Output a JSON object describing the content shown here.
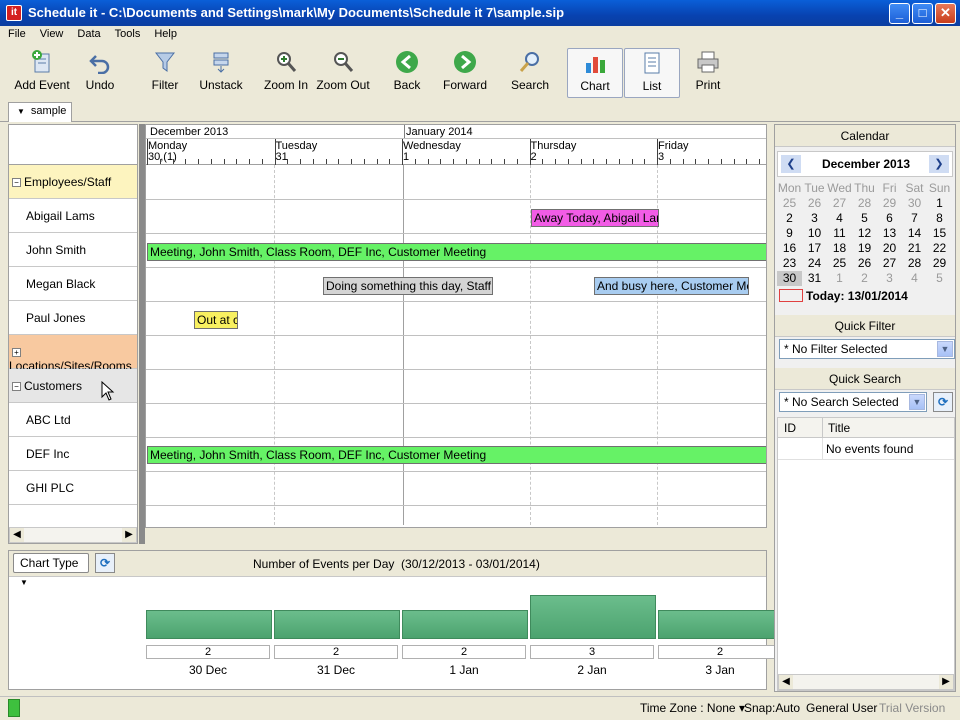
{
  "window": {
    "app_icon": "it",
    "title": "Schedule it - C:\\Documents and Settings\\mark\\My Documents\\Schedule it 7\\sample.sip",
    "min_label": "_",
    "max_label": "□",
    "close_label": "✕"
  },
  "menu": [
    "File",
    "View",
    "Data",
    "Tools",
    "Help"
  ],
  "toolbar": {
    "add_event": "Add Event",
    "undo": "Undo",
    "filter": "Filter",
    "unstack": "Unstack",
    "zoom_in": "Zoom In",
    "zoom_out": "Zoom Out",
    "back": "Back",
    "forward": "Forward",
    "search": "Search",
    "chart": "Chart",
    "list": "List",
    "print": "Print"
  },
  "tab": {
    "arrow": "▼",
    "label": "sample"
  },
  "resources": {
    "group_employees": "Employees/Staff",
    "abigail": "Abigail Lams",
    "john": "John Smith",
    "megan": "Megan Black",
    "paul": "Paul Jones",
    "group_locations": "Locations/Sites/Rooms",
    "group_customers": "Customers",
    "abc": "ABC Ltd",
    "def": "DEF Inc",
    "ghi": "GHI PLC",
    "collapse_glyph": "−",
    "expand_glyph": "+"
  },
  "timeline": {
    "month1": "December 2013",
    "month2": "January 2014",
    "days": [
      {
        "name": "Monday",
        "num": "30,(1)"
      },
      {
        "name": "Tuesday",
        "num": "31"
      },
      {
        "name": "Wednesday",
        "num": "1"
      },
      {
        "name": "Thursday",
        "num": "2"
      },
      {
        "name": "Friday",
        "num": "3"
      }
    ]
  },
  "events": {
    "abigail": "Away Today, Abigail Lams",
    "john": "Meeting, John Smith, Class Room, DEF Inc, Customer Meeting",
    "megan1": "Doing something this day, Staff Meeting",
    "megan2": "And busy here, Customer Meeting",
    "paul": "Out at c",
    "def": "Meeting, John Smith, Class Room, DEF Inc, Customer Meeting"
  },
  "event_colors": {
    "abigail": "#f25ce6",
    "meeting": "#66f266",
    "megan1": "#d4d4d4",
    "megan2": "#a8ccf0",
    "paul": "#f8f060"
  },
  "chart_panel": {
    "chart_type_label": "Chart Type",
    "dropdown_arrow": "▼",
    "refresh_glyph": "⟳",
    "title": "Number of Events per Day  (30/12/2013 - 03/01/2014)"
  },
  "chart_data": {
    "type": "bar",
    "title": "Number of Events per Day  (30/12/2013 - 03/01/2014)",
    "categories": [
      "30 Dec",
      "31 Dec",
      "1 Jan",
      "2 Jan",
      "3 Jan"
    ],
    "values": [
      2,
      2,
      2,
      3,
      2
    ],
    "ylim": [
      0,
      3
    ],
    "grid": false,
    "bar_color": "#5cb07e"
  },
  "calendar": {
    "header": "Calendar",
    "month_label": "December 2013",
    "prev": "❮",
    "next": "❯",
    "weekdays": [
      "Mon",
      "Tue",
      "Wed",
      "Thu",
      "Fri",
      "Sat",
      "Sun"
    ],
    "weeks": [
      [
        "25",
        "26",
        "27",
        "28",
        "29",
        "30",
        "1"
      ],
      [
        "2",
        "3",
        "4",
        "5",
        "6",
        "7",
        "8"
      ],
      [
        "9",
        "10",
        "11",
        "12",
        "13",
        "14",
        "15"
      ],
      [
        "16",
        "17",
        "18",
        "19",
        "20",
        "21",
        "22"
      ],
      [
        "23",
        "24",
        "25",
        "26",
        "27",
        "28",
        "29"
      ],
      [
        "30",
        "31",
        "1",
        "2",
        "3",
        "4",
        "5"
      ]
    ],
    "today_label": "Today: 13/01/2014"
  },
  "quick_filter": {
    "header": "Quick Filter",
    "value": "* No Filter Selected"
  },
  "quick_search": {
    "header": "Quick Search",
    "value": "* No Search Selected",
    "refresh_glyph": "⟳",
    "col_id": "ID",
    "col_title": "Title",
    "empty": "No events found"
  },
  "scroll": {
    "left": "◀",
    "right": "▶"
  },
  "status": {
    "timezone": "Time Zone : None",
    "tz_arrow": "▾",
    "snap": "Snap:Auto",
    "user": "General User",
    "version": "Trial Version"
  }
}
